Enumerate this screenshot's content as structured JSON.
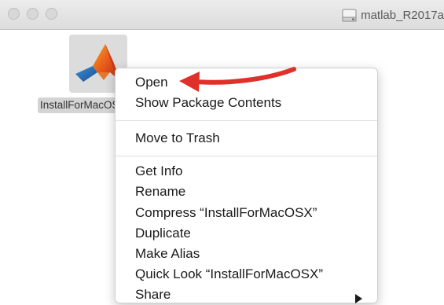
{
  "window": {
    "title": "matlab_R2017a",
    "controls": [
      "close-icon",
      "minimize-icon",
      "zoom-icon"
    ]
  },
  "file": {
    "name": "InstallForMacOSX",
    "icon": "matlab-logo-icon"
  },
  "context_menu": {
    "items": [
      "Open",
      "Show Package Contents",
      "Move to Trash",
      "Get Info",
      "Rename",
      "Compress “InstallForMacOSX”",
      "Duplicate",
      "Make Alias",
      "Quick Look “InstallForMacOSX”",
      "Share"
    ],
    "submenu_icon": "chevron-right-icon"
  },
  "annotation": {
    "icon": "red-arrow-icon",
    "color": "#e0302a"
  }
}
